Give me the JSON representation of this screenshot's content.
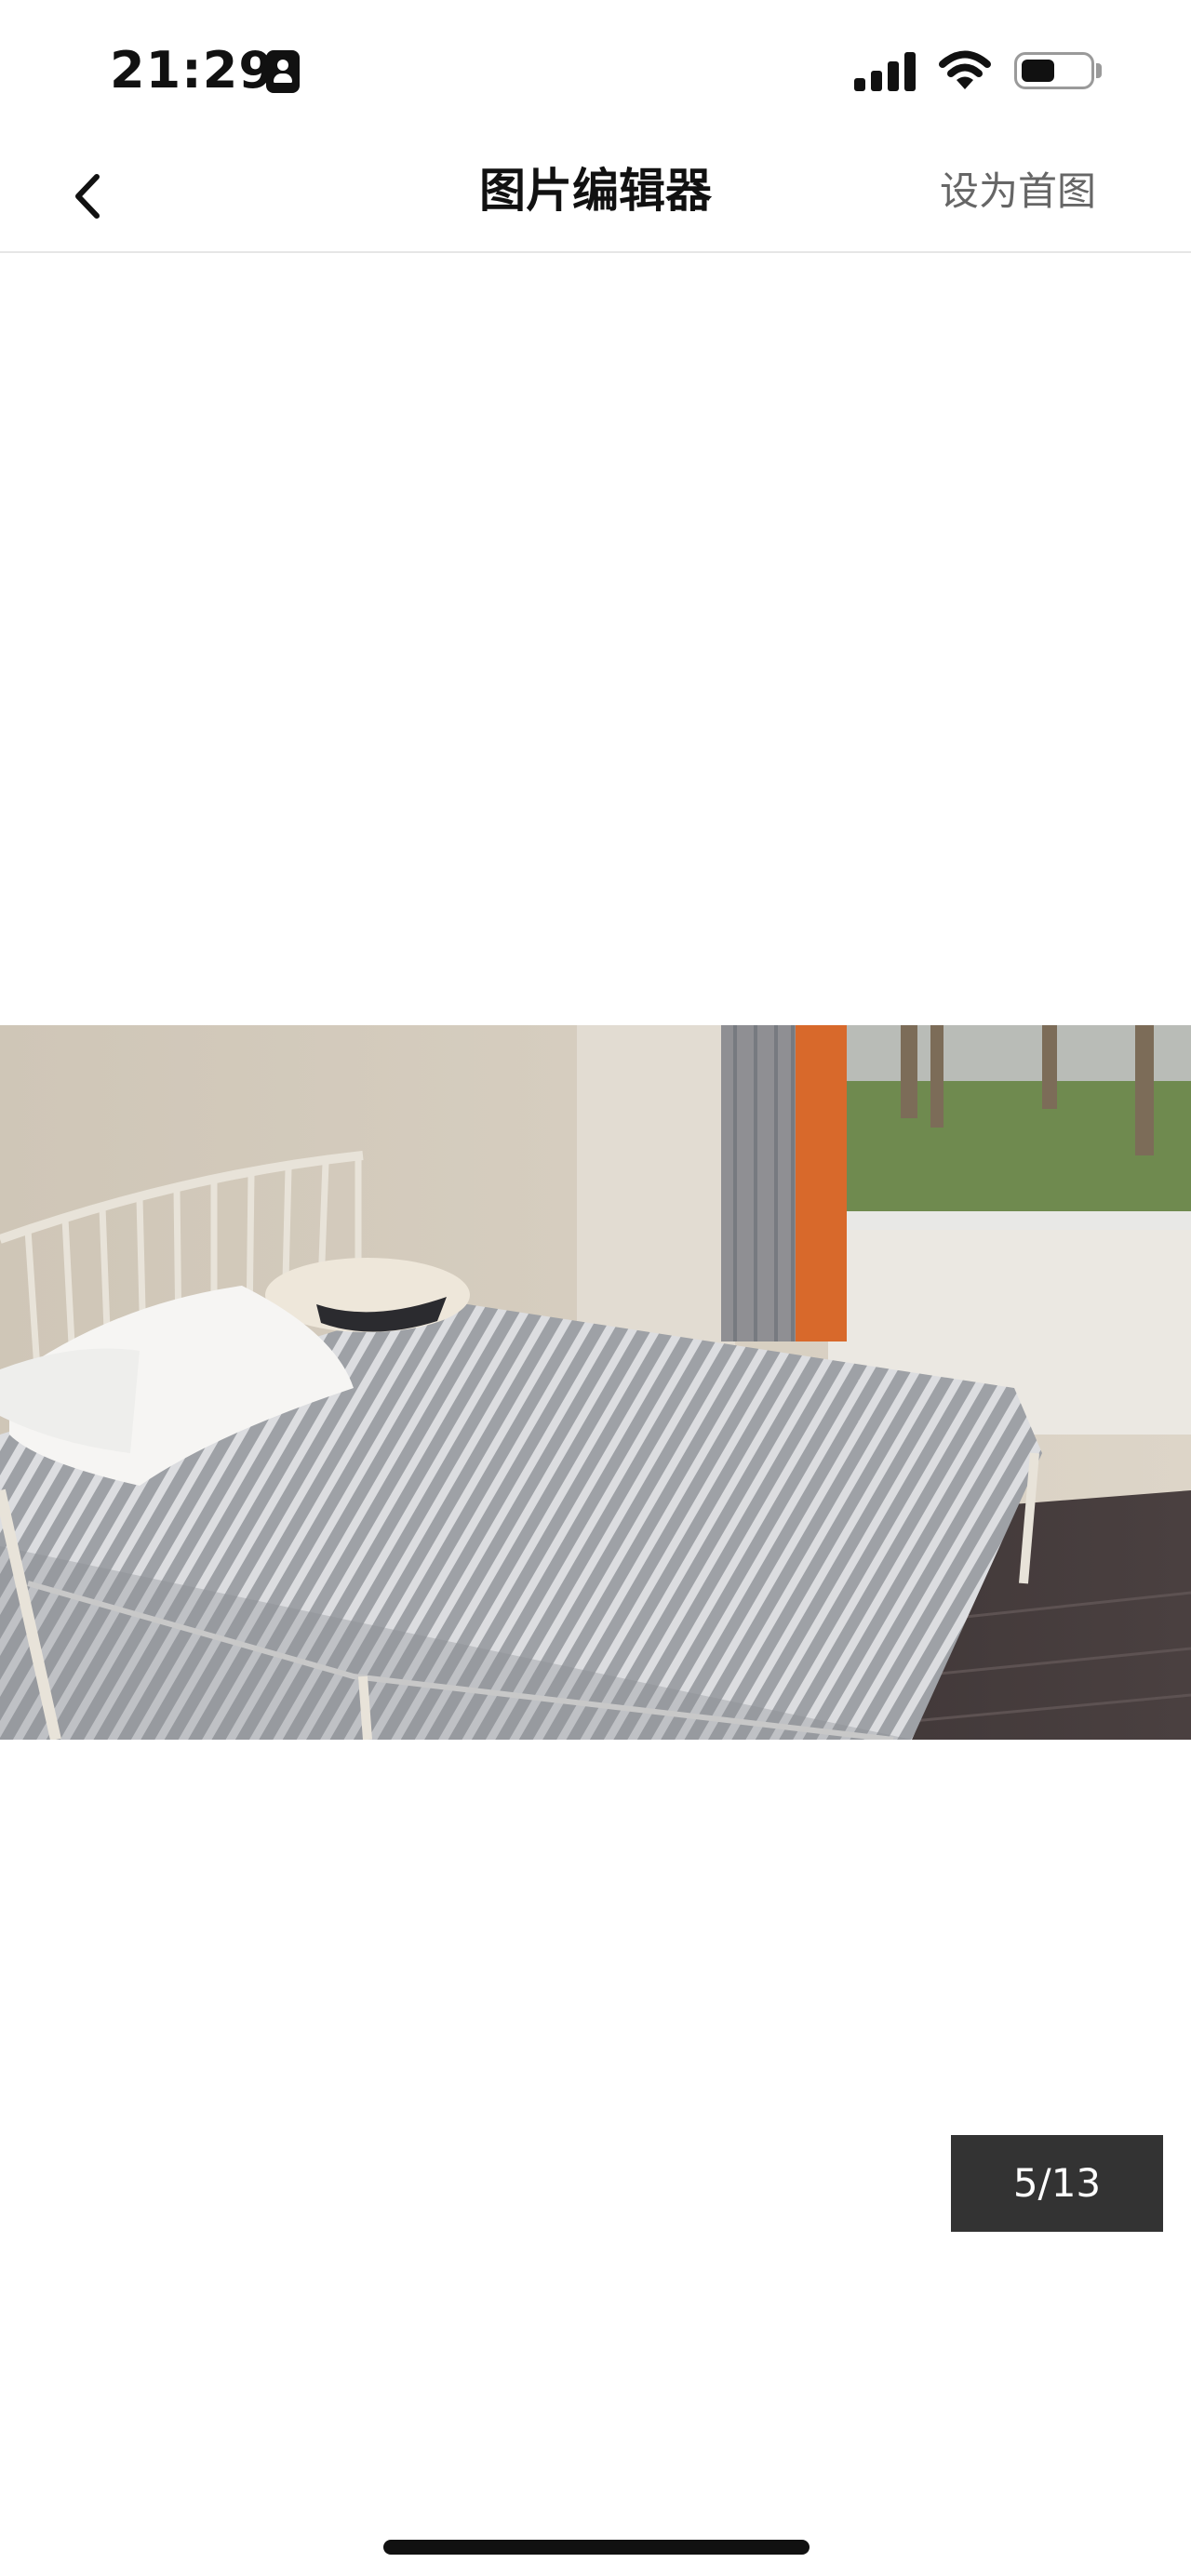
{
  "status_bar": {
    "time": "21:29",
    "signal_icon": "cellular-signal-icon",
    "wifi_icon": "wifi-icon",
    "battery_icon": "battery-icon",
    "battery_level": 0.5
  },
  "nav": {
    "title": "图片编辑器",
    "back_icon": "chevron-left-icon",
    "set_cover_label": "设为首图"
  },
  "photo": {
    "page_indicator": "5/13"
  },
  "colors": {
    "indicator_bg": "#333333",
    "action_text": "#666666"
  }
}
